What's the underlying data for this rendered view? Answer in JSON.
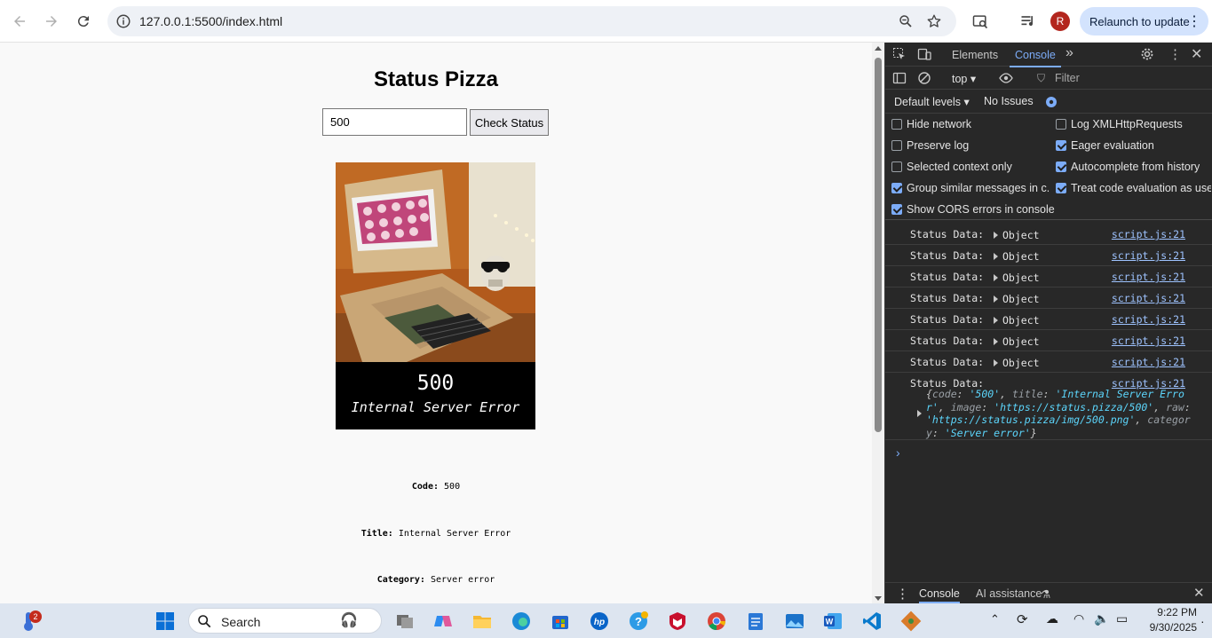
{
  "browser": {
    "url": "127.0.0.1:5500/index.html",
    "avatar_letter": "R",
    "relaunch_label": "Relaunch to update"
  },
  "page": {
    "title": "Status Pizza",
    "input_value": "500",
    "button_label": "Check Status",
    "pizza_code": "500",
    "pizza_title": "Internal Server Error",
    "code_label": "Code:",
    "code_value": "500",
    "title_label": "Title:",
    "title_value": "Internal Server Error",
    "category_label": "Category:",
    "category_value": "Server error"
  },
  "devtools": {
    "tabs": [
      "Elements",
      "Console"
    ],
    "context": "top",
    "filter_placeholder": "Filter",
    "levels": "Default levels",
    "issues": "No Issues",
    "options_left": [
      "Hide network",
      "Preserve log",
      "Selected context only",
      "Group similar messages in c...",
      "Show CORS errors in console"
    ],
    "options_right": [
      "Log XMLHttpRequests",
      "Eager evaluation",
      "Autocomplete from history",
      "Treat code evaluation as use..."
    ],
    "options_left_checked": [
      false,
      false,
      false,
      true,
      true
    ],
    "options_right_checked": [
      false,
      true,
      true,
      true
    ],
    "log_label": "Status Data:",
    "log_object": "Object",
    "log_source": "script.js:21",
    "expanded": {
      "line1_code_key": "code",
      "line1_code_val": "'500'",
      "title_key": "title",
      "title_val": "'Internal Server Error'",
      "image_key": "image",
      "image_val": "'https://status.pizza/500'",
      "raw_key": "raw",
      "raw_val": "'https://status.pizza/img/500.png'",
      "category_key": "category",
      "category_val": "'Server error'"
    },
    "drawer_tabs": [
      "Console",
      "AI assistance"
    ]
  },
  "taskbar": {
    "search_label": "Search",
    "time": "9:22 PM",
    "date": "9/30/2025",
    "badge_count": "2"
  },
  "colors": {
    "accent": "#7cacf8",
    "relaunch_bg": "#d3e3fd",
    "avatar_bg": "#b3261e",
    "devtools_bg": "#282828"
  }
}
